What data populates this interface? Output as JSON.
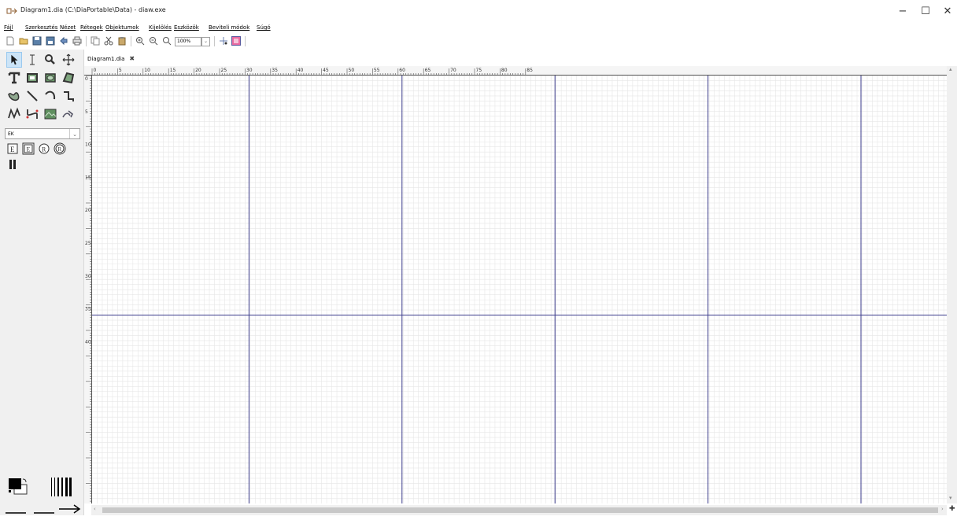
{
  "window": {
    "title": "Diagram1.dia (C:\\DiaPortable\\Data) - diaw.exe",
    "minimize_glyph": "−",
    "maximize_glyph": "☐",
    "close_glyph": "✕"
  },
  "menu": {
    "items": [
      "Fájl",
      "Szerkesztés",
      "Nézet",
      "Rétegek",
      "Objektumok",
      "Kijelölés",
      "Eszközök",
      "Beviteli módok",
      "Súgó"
    ]
  },
  "toolbar": {
    "zoom_value": "100%",
    "zoom_dropdown_glyph": "⌄",
    "icons": [
      "new-icon",
      "open-icon",
      "save-icon",
      "save-as-icon",
      "export-icon",
      "print-icon",
      "copy-icon",
      "cut-icon",
      "paste-icon",
      "zoom-in-icon",
      "zoom-out-icon",
      "zoom-fit-icon",
      "snap-to-grid-icon",
      "snap-to-objects-icon"
    ]
  },
  "toolbox": {
    "sheet_value": "EK",
    "sheet_dropdown_glyph": "⌄",
    "tools": [
      "pointer-icon",
      "text-edit-icon",
      "magnify-icon",
      "scroll-icon",
      "text-icon",
      "box-icon",
      "ellipse-icon",
      "polygon-icon",
      "beziergon-icon",
      "line-icon",
      "arc-icon",
      "zigzag-line-icon",
      "polyline-icon",
      "bezier-line-icon",
      "image-icon",
      "outline-icon"
    ],
    "sheet_shapes": [
      "entity-icon",
      "weak-entity-icon",
      "relationship-icon",
      "weak-relationship-icon",
      "attribute-icon"
    ],
    "line_width_glyph": "━━",
    "line_style_glyph": "━━━━",
    "arrow_glyph": "⟶"
  },
  "tabs": [
    {
      "label": "Diagram1.dia",
      "close_glyph": "✖"
    }
  ],
  "ruler": {
    "horizontal_labels": [
      "0",
      "5",
      "10",
      "15",
      "20",
      "25",
      "30",
      "35",
      "40",
      "45",
      "50",
      "55",
      "60",
      "65",
      "70",
      "75",
      "80",
      "85"
    ],
    "vertical_labels": [
      "0",
      "5",
      "10",
      "15",
      "20",
      "25",
      "30",
      "35",
      "40"
    ]
  },
  "colors": {
    "page_break": "#3c3d8c",
    "grid": "#e6e6e6",
    "ruler_bg": "#f5f5f5",
    "accent": "#cce4f7"
  },
  "scrollbars": {
    "up_arrow": "▴",
    "down_arrow": "▾",
    "left_arrow": "‹",
    "right_arrow": "›",
    "corner_glyph": "✚"
  }
}
